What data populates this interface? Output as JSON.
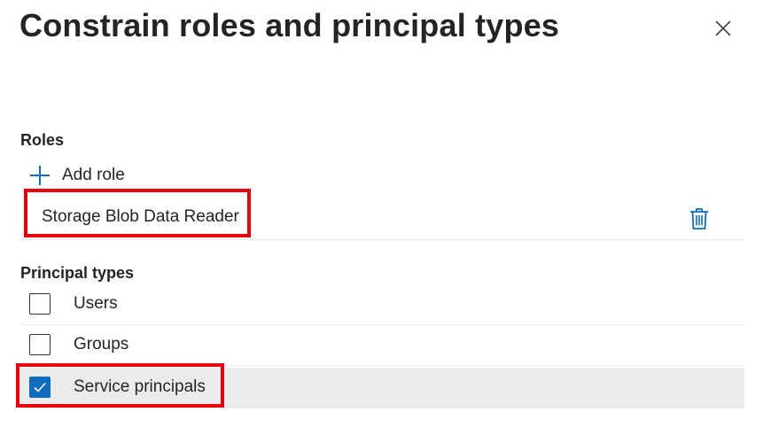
{
  "panel": {
    "title": "Constrain roles and principal types",
    "close_icon": "close-icon"
  },
  "roles": {
    "label": "Roles",
    "add_label": "Add role",
    "add_icon": "plus-icon",
    "items": [
      {
        "name": "Storage Blob Data Reader",
        "delete_icon": "trash-icon"
      }
    ]
  },
  "principal_types": {
    "label": "Principal types",
    "options": [
      {
        "label": "Users",
        "checked": false
      },
      {
        "label": "Groups",
        "checked": false
      },
      {
        "label": "Service principals",
        "checked": true
      }
    ]
  },
  "colors": {
    "accent": "#0f6cbd",
    "highlight": "#e8000d",
    "selected_row": "#ebebeb"
  }
}
